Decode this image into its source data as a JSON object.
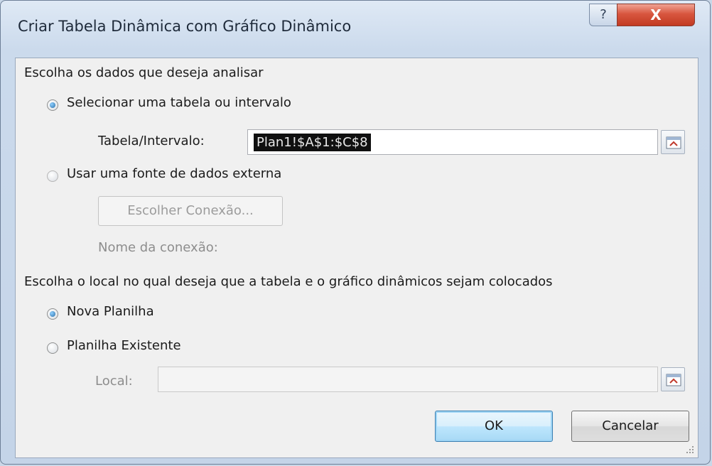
{
  "window": {
    "title": "Criar Tabela Dinâmica com Gráfico Dinâmico",
    "help_label": "?",
    "close_label": "X"
  },
  "data_section": {
    "heading": "Escolha os dados que deseja analisar",
    "option_table": "Selecionar uma tabela ou intervalo",
    "table_range_label": "Tabela/Intervalo:",
    "table_range_value": "Plan1!$A$1:$C$8",
    "option_external": "Usar uma fonte de dados externa",
    "choose_connection_label": "Escolher Conexão...",
    "connection_name_label": "Nome da conexão:"
  },
  "location_section": {
    "heading": "Escolha o local no qual deseja que a tabela e o gráfico dinâmicos sejam colocados",
    "option_new_sheet": "Nova Planilha",
    "option_existing_sheet": "Planilha Existente",
    "location_label": "Local:",
    "location_value": ""
  },
  "buttons": {
    "ok": "OK",
    "cancel": "Cancelar"
  },
  "state": {
    "data_source_selected": "table",
    "destination_selected": "new_sheet"
  },
  "icons": {
    "collapse_dialog": "collapse-dialog-icon",
    "resize_grip": "resize-grip-icon"
  }
}
